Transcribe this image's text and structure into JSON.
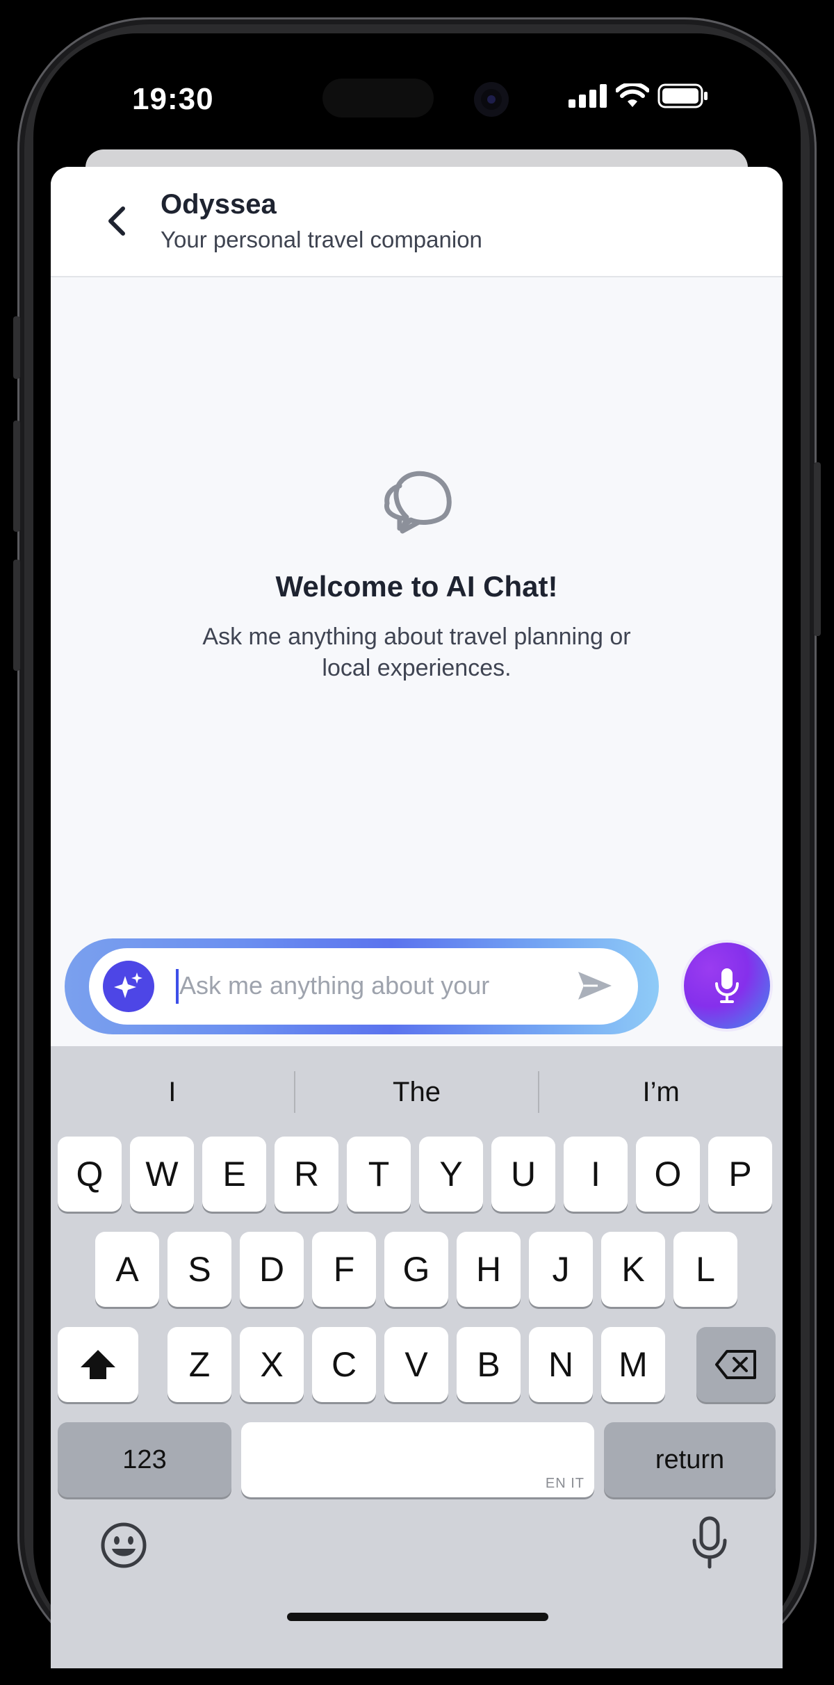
{
  "status_bar": {
    "time": "19:30"
  },
  "header": {
    "title": "Odyssea",
    "subtitle": "Your personal travel companion"
  },
  "empty_state": {
    "title": "Welcome to AI Chat!",
    "subtitle": "Ask me anything about travel planning or local experiences."
  },
  "composer": {
    "placeholder": "Ask me anything about your"
  },
  "keyboard": {
    "suggestions": [
      "I",
      "The",
      "I’m"
    ],
    "row1": [
      "Q",
      "W",
      "E",
      "R",
      "T",
      "Y",
      "U",
      "I",
      "O",
      "P"
    ],
    "row2": [
      "A",
      "S",
      "D",
      "F",
      "G",
      "H",
      "J",
      "K",
      "L"
    ],
    "row3": [
      "Z",
      "X",
      "C",
      "V",
      "B",
      "N",
      "M"
    ],
    "numbers_label": "123",
    "return_label": "return",
    "space_languages": "EN IT"
  },
  "icons": {
    "back": "chevron-left-icon",
    "chat": "chat-bubbles-icon",
    "sparkles": "sparkles-icon",
    "send": "send-icon",
    "mic": "microphone-icon",
    "shift": "shift-icon",
    "delete": "delete-icon",
    "emoji": "emoji-icon",
    "dictation": "dictation-mic-icon"
  },
  "colors": {
    "accent": "#4d46e6",
    "mic_gradient_start": "#9a3cf0",
    "mic_gradient_end": "#3f8fee"
  }
}
